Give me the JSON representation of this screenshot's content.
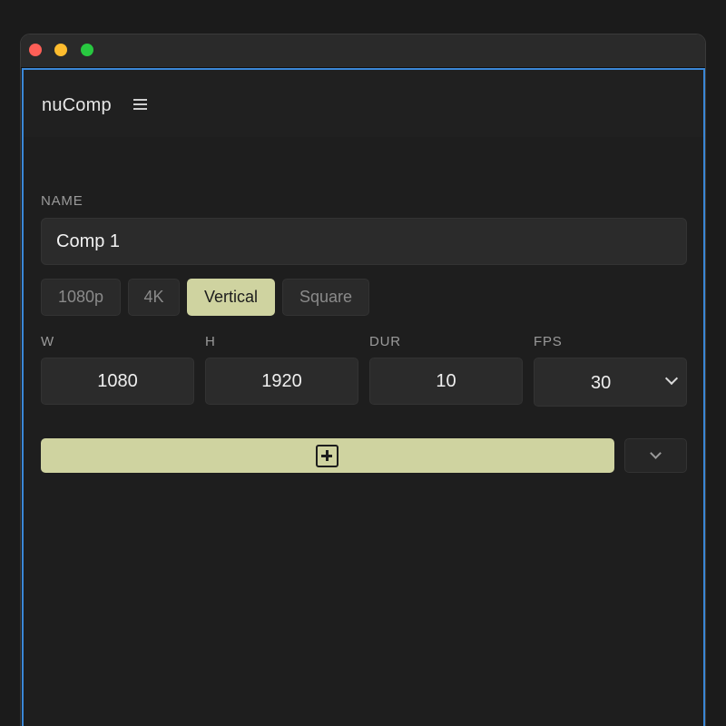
{
  "app": {
    "title": "nuComp"
  },
  "form": {
    "name_label": "NAME",
    "name_value": "Comp 1",
    "presets": [
      {
        "label": "1080p",
        "active": false
      },
      {
        "label": "4K",
        "active": false
      },
      {
        "label": "Vertical",
        "active": true
      },
      {
        "label": "Square",
        "active": false
      }
    ],
    "width_label": "W",
    "width_value": "1080",
    "height_label": "H",
    "height_value": "1920",
    "duration_label": "DUR",
    "duration_value": "10",
    "fps_label": "FPS",
    "fps_value": "30"
  },
  "icons": {
    "menu": "menu-icon",
    "add": "add-square-icon",
    "dropdown": "chevron-down-icon"
  },
  "colors": {
    "accent": "#cfd3a0",
    "focus_border": "#3a87d6",
    "background": "#1e1e1e"
  }
}
